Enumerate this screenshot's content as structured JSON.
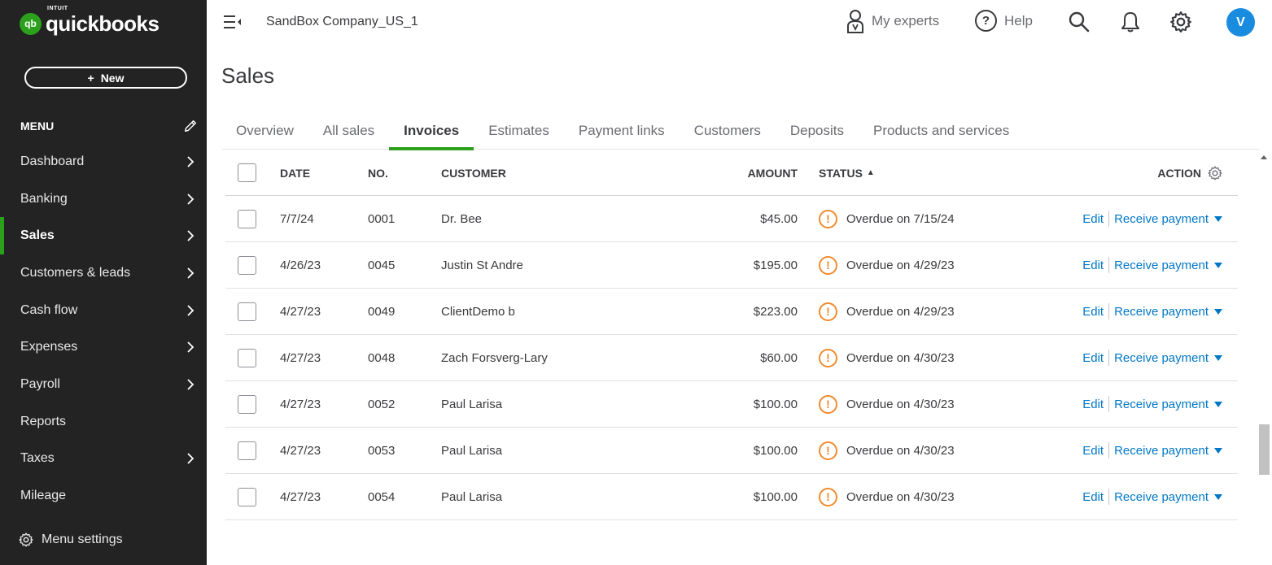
{
  "brand": {
    "intuit": "INTUIT",
    "wordmark": "quickbooks",
    "mark": "qb"
  },
  "sidebar": {
    "new_label": "New",
    "menu_label": "MENU",
    "items": [
      {
        "label": "Dashboard",
        "chevron": true
      },
      {
        "label": "Banking",
        "chevron": true
      },
      {
        "label": "Sales",
        "chevron": true,
        "active": true
      },
      {
        "label": "Customers & leads",
        "chevron": true
      },
      {
        "label": "Cash flow",
        "chevron": true
      },
      {
        "label": "Expenses",
        "chevron": true
      },
      {
        "label": "Payroll",
        "chevron": true
      },
      {
        "label": "Reports",
        "chevron": false
      },
      {
        "label": "Taxes",
        "chevron": true
      },
      {
        "label": "Mileage",
        "chevron": false
      }
    ],
    "menu_settings": "Menu settings"
  },
  "topbar": {
    "company": "SandBox Company_US_1",
    "experts": "My experts",
    "help": "Help",
    "avatar": "V"
  },
  "page": {
    "title": "Sales",
    "tabs": [
      "Overview",
      "All sales",
      "Invoices",
      "Estimates",
      "Payment links",
      "Customers",
      "Deposits",
      "Products and services"
    ],
    "active_tab": "Invoices"
  },
  "table": {
    "headers": {
      "date": "DATE",
      "no": "NO.",
      "customer": "CUSTOMER",
      "amount": "AMOUNT",
      "status": "STATUS",
      "action": "ACTION"
    },
    "rows": [
      {
        "date": "7/7/24",
        "no": "0001",
        "customer": "Dr. Bee",
        "amount": "$45.00",
        "status": "Overdue on 7/15/24"
      },
      {
        "date": "4/26/23",
        "no": "0045",
        "customer": "Justin St Andre",
        "amount": "$195.00",
        "status": "Overdue on 4/29/23"
      },
      {
        "date": "4/27/23",
        "no": "0049",
        "customer": "ClientDemo b",
        "amount": "$223.00",
        "status": "Overdue on 4/29/23"
      },
      {
        "date": "4/27/23",
        "no": "0048",
        "customer": "Zach Forsverg-Lary",
        "amount": "$60.00",
        "status": "Overdue on 4/30/23"
      },
      {
        "date": "4/27/23",
        "no": "0052",
        "customer": "Paul Larisa",
        "amount": "$100.00",
        "status": "Overdue on 4/30/23"
      },
      {
        "date": "4/27/23",
        "no": "0053",
        "customer": "Paul Larisa",
        "amount": "$100.00",
        "status": "Overdue on 4/30/23"
      },
      {
        "date": "4/27/23",
        "no": "0054",
        "customer": "Paul Larisa",
        "amount": "$100.00",
        "status": "Overdue on 4/30/23"
      }
    ],
    "edit_label": "Edit",
    "receive_label": "Receive payment"
  },
  "colors": {
    "brand_green": "#2ca01c",
    "link_blue": "#0077c5",
    "overdue_orange": "#f08b2e",
    "sidebar_bg": "#232323"
  }
}
